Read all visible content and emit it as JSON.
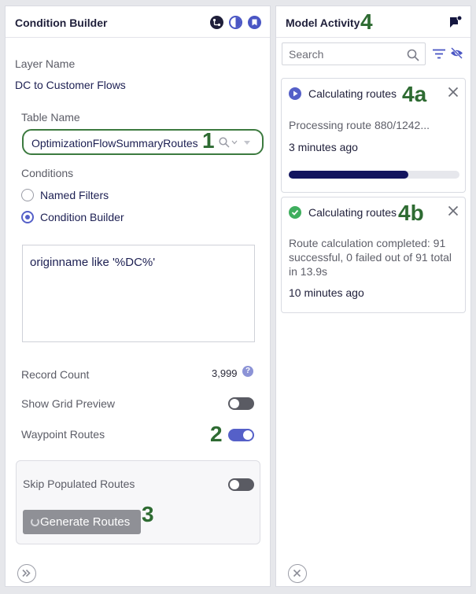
{
  "condition_builder": {
    "title": "Condition Builder",
    "header_icons": [
      "route-icon",
      "contrast-icon",
      "bookmark-icon"
    ],
    "layer_name_label": "Layer Name",
    "layer_name_value": "DC to Customer Flows",
    "table_name_label": "Table Name",
    "table_name_value": "OptimizationFlowSummaryRoutes",
    "conditions_label": "Conditions",
    "condition_options": [
      {
        "label": "Named Filters",
        "selected": false
      },
      {
        "label": "Condition Builder",
        "selected": true
      }
    ],
    "condition_text": "originname like '%DC%'",
    "record_count_label": "Record Count",
    "record_count_value": "3,999",
    "show_grid_preview_label": "Show Grid Preview",
    "show_grid_preview_on": false,
    "waypoint_routes_label": "Waypoint Routes",
    "waypoint_routes_on": true,
    "skip_populated_label": "Skip Populated Routes",
    "skip_populated_on": false,
    "generate_button_label": "Generate Routes"
  },
  "model_activity": {
    "title": "Model Activity",
    "search_placeholder": "Search",
    "cards": [
      {
        "title": "Calculating routes",
        "status": "running",
        "message": "Processing route 880/1242...",
        "time": "3 minutes ago",
        "progress": 0.7
      },
      {
        "title": "Calculating routes",
        "status": "completed",
        "message": "Route calculation completed: 91 successful, 0 failed out of 91 total in 13.9s",
        "time": "10 minutes ago"
      }
    ]
  },
  "callouts": {
    "c1": "1",
    "c2": "2",
    "c3": "3",
    "c4": "4",
    "c4a": "4a",
    "c4b": "4b"
  },
  "colors": {
    "accent": "#5560c8",
    "progress": "#12145e",
    "success": "#3fae5e",
    "callout": "#2e6b32"
  }
}
